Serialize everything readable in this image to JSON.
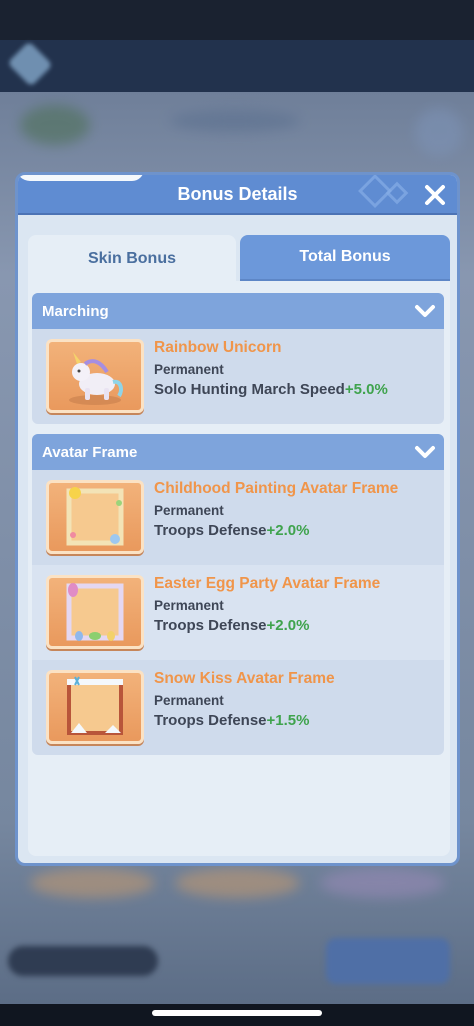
{
  "modal": {
    "title": "Bonus Details"
  },
  "tabs": [
    {
      "label": "Skin Bonus",
      "active": true
    },
    {
      "label": "Total Bonus",
      "active": false
    }
  ],
  "sections": [
    {
      "title": "Marching",
      "items": [
        {
          "name": "Rainbow Unicorn",
          "duration": "Permanent",
          "bonus_label": "Solo Hunting March Speed",
          "bonus_value": "+5.0%",
          "icon": "unicorn-icon"
        }
      ]
    },
    {
      "title": "Avatar Frame",
      "items": [
        {
          "name": "Childhood Painting Avatar Frame",
          "duration": "Permanent",
          "bonus_label": "Troops Defense",
          "bonus_value": "+2.0%",
          "icon": "painting-frame-icon"
        },
        {
          "name": "Easter Egg Party Avatar Frame",
          "duration": "Permanent",
          "bonus_label": "Troops Defense",
          "bonus_value": "+2.0%",
          "icon": "easter-frame-icon"
        },
        {
          "name": "Snow Kiss Avatar Frame",
          "duration": "Permanent",
          "bonus_label": "Troops Defense",
          "bonus_value": "+1.5%",
          "icon": "snow-frame-icon"
        }
      ]
    }
  ],
  "colors": {
    "header": "#5f8cd2",
    "item_name": "#f0954a",
    "bonus_value": "#3fa34d",
    "section_head": "#7ea4dc"
  }
}
